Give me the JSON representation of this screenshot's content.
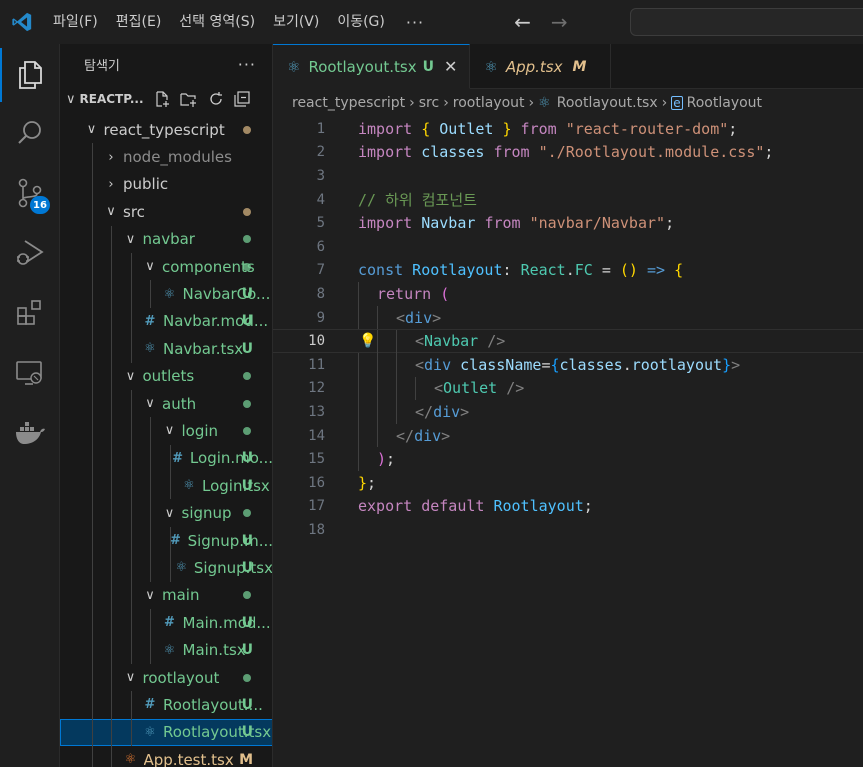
{
  "menu": [
    "파일(F)",
    "편집(E)",
    "선택 영역(S)",
    "보기(V)",
    "이동(G)"
  ],
  "menu_more": "···",
  "nav": {
    "back": "←",
    "forward": "→"
  },
  "activity": {
    "scm_badge": "16"
  },
  "sidebar": {
    "title": "탐색기",
    "more": "···",
    "section": "REACTP...",
    "tree": [
      {
        "label": "react_typescript",
        "chev": "∨",
        "indent": 1,
        "kind": "folder",
        "dot": "tan"
      },
      {
        "label": "node_modules",
        "chev": "›",
        "indent": 2,
        "kind": "folder-dim"
      },
      {
        "label": "public",
        "chev": "›",
        "indent": 2,
        "kind": "folder"
      },
      {
        "label": "src",
        "chev": "∨",
        "indent": 2,
        "kind": "folder",
        "dot": "tan"
      },
      {
        "label": "navbar",
        "chev": "∨",
        "indent": 3,
        "kind": "folder-green",
        "dot": "green"
      },
      {
        "label": "components",
        "chev": "∨",
        "indent": 4,
        "kind": "folder-green",
        "dot": "green"
      },
      {
        "label": "NavbarCo...",
        "indent": 5,
        "kind": "react",
        "status": "U"
      },
      {
        "label": "Navbar.mod...",
        "indent": 4,
        "kind": "css",
        "status": "U"
      },
      {
        "label": "Navbar.tsx",
        "indent": 4,
        "kind": "react",
        "status": "U"
      },
      {
        "label": "outlets",
        "chev": "∨",
        "indent": 3,
        "kind": "folder-green",
        "dot": "green"
      },
      {
        "label": "auth",
        "chev": "∨",
        "indent": 4,
        "kind": "folder-green",
        "dot": "green"
      },
      {
        "label": "login",
        "chev": "∨",
        "indent": 5,
        "kind": "folder-green",
        "dot": "green"
      },
      {
        "label": "Login.mo...",
        "indent": 6,
        "kind": "css",
        "status": "U"
      },
      {
        "label": "Login.tsx",
        "indent": 6,
        "kind": "react",
        "status": "U"
      },
      {
        "label": "signup",
        "chev": "∨",
        "indent": 5,
        "kind": "folder-green",
        "dot": "green"
      },
      {
        "label": "Signup.m...",
        "indent": 6,
        "kind": "css",
        "status": "U"
      },
      {
        "label": "Signup.tsx",
        "indent": 6,
        "kind": "react",
        "status": "U"
      },
      {
        "label": "main",
        "chev": "∨",
        "indent": 4,
        "kind": "folder-green",
        "dot": "green"
      },
      {
        "label": "Main.mod...",
        "indent": 5,
        "kind": "css",
        "status": "U"
      },
      {
        "label": "Main.tsx",
        "indent": 5,
        "kind": "react",
        "status": "U"
      },
      {
        "label": "rootlayout",
        "chev": "∨",
        "indent": 3,
        "kind": "folder-green",
        "dot": "green"
      },
      {
        "label": "Rootlayout....",
        "indent": 4,
        "kind": "css",
        "status": "U"
      },
      {
        "label": "Rootlayout.tsx",
        "indent": 4,
        "kind": "react",
        "status": "U",
        "selected": true
      },
      {
        "label": "App.test.tsx",
        "indent": 3,
        "kind": "test",
        "status": "M"
      }
    ]
  },
  "tabs": [
    {
      "name": "Rootlayout.tsx",
      "status": "U",
      "close": "✕",
      "active": true
    },
    {
      "name": "App.tsx",
      "status": "M",
      "active": false
    }
  ],
  "breadcrumb": [
    "react_typescript",
    "src",
    "rootlayout",
    "Rootlayout.tsx",
    "Rootlayout"
  ],
  "code": {
    "current_line": 10,
    "lines": [
      "1",
      "2",
      "3",
      "4",
      "5",
      "6",
      "7",
      "8",
      "9",
      "10",
      "11",
      "12",
      "13",
      "14",
      "15",
      "16",
      "17",
      "18"
    ],
    "text": {
      "l1_import": "import",
      "l1_lb": "{",
      "l1_name": " Outlet ",
      "l1_rb": "}",
      "l1_from": " from ",
      "l1_str": "\"react-router-dom\"",
      "l1_semi": ";",
      "l2_import": "import",
      "l2_name": " classes ",
      "l2_from": "from ",
      "l2_str": "\"./Rootlayout.module.css\"",
      "l2_semi": ";",
      "l4_comment": "// 하위 컴포넌트",
      "l5_import": "import",
      "l5_name": " Navbar ",
      "l5_from": "from ",
      "l5_str": "\"navbar/Navbar\"",
      "l5_semi": ";",
      "l7_const": "const",
      "l7_name": " Rootlayout",
      "l7_colon": ": ",
      "l7_type": "React",
      "l7_dot": ".",
      "l7_fc": "FC",
      "l7_eq": " = ",
      "l7_paren": "()",
      "l7_arrow": " => ",
      "l7_brace": "{",
      "l8_return": "return",
      "l8_paren": " (",
      "l9_open": "<",
      "l9_tag": "div",
      "l9_close": ">",
      "l10_open": "<",
      "l10_tag": "Navbar",
      "l10_close": " />",
      "l11_open": "<",
      "l11_tag": "div",
      "l11_attr": " className",
      "l11_eq": "=",
      "l11_lb": "{",
      "l11_val": "classes",
      "l11_dot": ".",
      "l11_prop": "rootlayout",
      "l11_rb": "}",
      "l11_close": ">",
      "l12_open": "<",
      "l12_tag": "Outlet",
      "l12_close": " />",
      "l13_open": "</",
      "l13_tag": "div",
      "l13_close": ">",
      "l14_open": "</",
      "l14_tag": "div",
      "l14_close": ">",
      "l15_paren": ")",
      "l15_semi": ";",
      "l16_brace": "}",
      "l16_semi": ";",
      "l17_export": "export",
      "l17_default": " default",
      "l17_name": " Rootlayout",
      "l17_semi": ";"
    }
  },
  "colors": {
    "accent": "#0078d4",
    "untracked": "#73c991",
    "modified": "#e2c08d"
  }
}
